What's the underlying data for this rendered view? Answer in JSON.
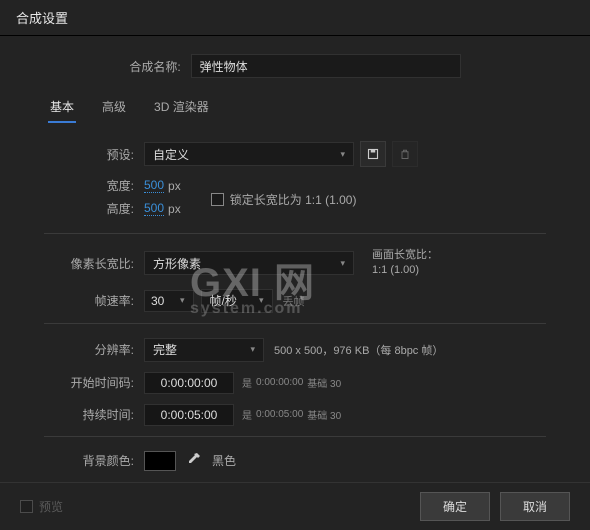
{
  "dialog": {
    "title": "合成设置"
  },
  "compName": {
    "label": "合成名称:",
    "value": "弹性物体"
  },
  "tabs": {
    "basic": "基本",
    "advanced": "高级",
    "renderer": "3D 渲染器"
  },
  "preset": {
    "label": "预设:",
    "value": "自定义"
  },
  "width": {
    "label": "宽度:",
    "value": "500",
    "unit": "px"
  },
  "height": {
    "label": "高度:",
    "value": "500",
    "unit": "px"
  },
  "lockAspect": {
    "label": "锁定长宽比为",
    "ratio": "1:1 (1.00)"
  },
  "pixelAspect": {
    "label": "像素长宽比:",
    "value": "方形像素"
  },
  "frameAspect": {
    "label": "画面长宽比：",
    "value": "1:1 (1.00)"
  },
  "frameRate": {
    "label": "帧速率:",
    "value": "30",
    "unit": "帧/秒",
    "drop": "丢帧"
  },
  "resolution": {
    "label": "分辨率:",
    "value": "完整",
    "info": "500 x 500，976 KB（每 8bpc 帧）"
  },
  "startTc": {
    "label": "开始时间码:",
    "value": "0:00:00:00",
    "meta1": "是",
    "meta2": "0:00:00:00",
    "meta3": "基础 30"
  },
  "duration": {
    "label": "持续时间:",
    "value": "0:00:05:00",
    "meta1": "是",
    "meta2": "0:00:05:00",
    "meta3": "基础 30"
  },
  "bgColor": {
    "label": "背景颜色:",
    "name": "黑色",
    "hex": "#000000"
  },
  "footer": {
    "preview": "预览",
    "ok": "确定",
    "cancel": "取消"
  },
  "watermark": {
    "main": "GXI 网",
    "sub": "system.com"
  }
}
